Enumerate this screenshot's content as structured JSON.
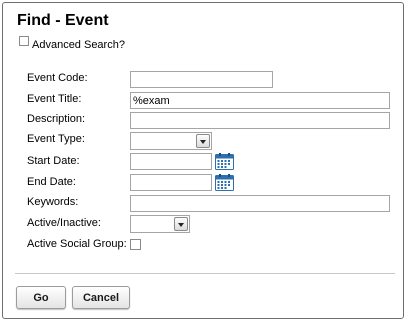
{
  "dialog": {
    "title": "Find - Event",
    "advanced_search_label": "Advanced Search?",
    "advanced_search_checked": false
  },
  "form": {
    "event_code": {
      "label": "Event Code:",
      "value": ""
    },
    "event_title": {
      "label": "Event Title:",
      "value": "%exam"
    },
    "description": {
      "label": "Description:",
      "value": ""
    },
    "event_type": {
      "label": "Event Type:",
      "selected": ""
    },
    "start_date": {
      "label": "Start Date:",
      "value": "",
      "icon": "calendar-icon"
    },
    "end_date": {
      "label": "End Date:",
      "value": "",
      "icon": "calendar-icon"
    },
    "keywords": {
      "label": "Keywords:",
      "value": ""
    },
    "active_inactive": {
      "label": "Active/Inactive:",
      "selected": ""
    },
    "active_social_group": {
      "label": "Active Social Group:",
      "checked": false
    }
  },
  "buttons": {
    "go_label": "Go",
    "cancel_label": "Cancel"
  },
  "colors": {
    "calendar_blue": "#2f6fae",
    "border": "#a5a5a5"
  }
}
